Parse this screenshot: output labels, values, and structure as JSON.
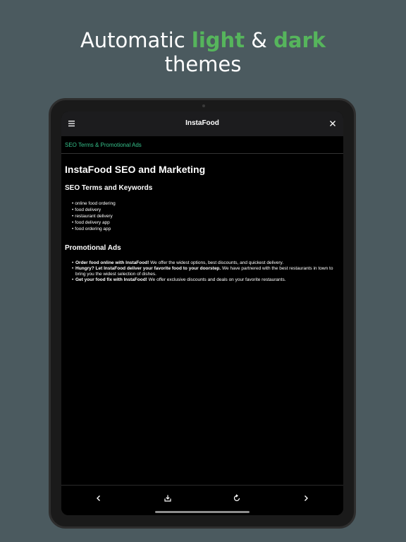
{
  "headline": {
    "line1_prefix": "Automatic ",
    "line1_light": "light",
    "line1_amp": " & ",
    "line1_dark": "dark",
    "line2": "themes"
  },
  "colors": {
    "background": "#4b5a5f",
    "accent_green": "#56b55c",
    "link_teal": "#35c08a"
  },
  "app": {
    "title": "InstaFood",
    "menu_icon": "hamburger-menu-icon",
    "close_icon": "close-icon",
    "tab_label": "SEO Terms & Promotional Ads"
  },
  "content": {
    "title": "InstaFood SEO and Marketing",
    "keywords_heading": "SEO Terms and Keywords",
    "keywords": [
      "online food ordering",
      "food delivery",
      "restaurant delivery",
      "food delivery app",
      "food ordering app"
    ],
    "ads_heading": "Promotional Ads",
    "ads": [
      {
        "bold": "Order food online with InstaFood!",
        "text": " We offer the widest options, best discounts, and quickest delivery."
      },
      {
        "bold": "Hungry? Let InstaFood deliver your favorite food to your doorstep.",
        "text": " We have partnered with the best restaurants in town to bring you the widest selection of dishes."
      },
      {
        "bold": "Get your food fix with InstaFood!",
        "text": " We offer exclusive discounts and deals on your favorite restaurants."
      }
    ]
  },
  "toolbar": {
    "back_icon": "chevron-left-icon",
    "download_icon": "download-icon",
    "refresh_icon": "refresh-icon",
    "forward_icon": "chevron-right-icon"
  }
}
